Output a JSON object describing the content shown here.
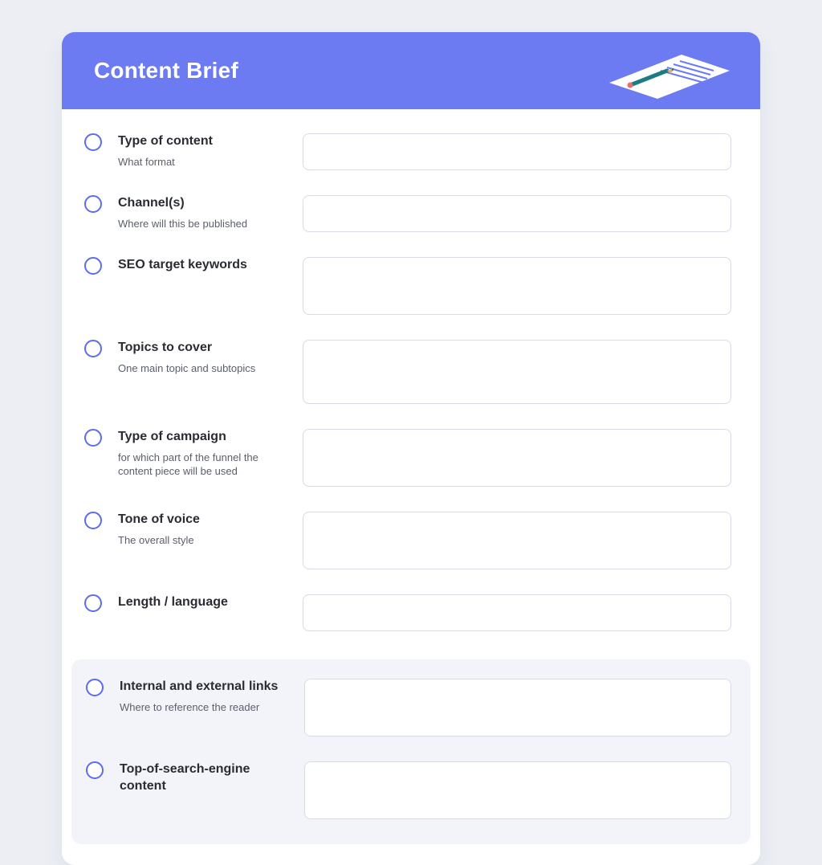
{
  "header": {
    "title": "Content Brief"
  },
  "fields": [
    {
      "id": "type-of-content",
      "title": "Type of content",
      "sub": "What format",
      "size": "sm",
      "value": ""
    },
    {
      "id": "channels",
      "title": "Channel(s)",
      "sub": "Where will this be published",
      "size": "sm",
      "value": ""
    },
    {
      "id": "seo-keywords",
      "title": "SEO target keywords",
      "sub": "",
      "size": "md",
      "value": ""
    },
    {
      "id": "topics-to-cover",
      "title": "Topics to cover",
      "sub": "One main topic and subtopics",
      "size": "lg",
      "value": ""
    },
    {
      "id": "type-of-campaign",
      "title": "Type of campaign",
      "sub": "for which part of the funnel the content piece will be used",
      "size": "md",
      "value": ""
    },
    {
      "id": "tone-of-voice",
      "title": "Tone of voice",
      "sub": "The overall style",
      "size": "md",
      "value": ""
    },
    {
      "id": "length-language",
      "title": "Length / language",
      "sub": "",
      "size": "sm",
      "value": ""
    }
  ],
  "secondary_fields": [
    {
      "id": "internal-external-links",
      "title": "Internal and external links",
      "sub": "Where to reference the reader",
      "size": "md",
      "value": ""
    },
    {
      "id": "top-of-search-content",
      "title": "Top-of-search-engine content",
      "sub": "",
      "size": "md",
      "value": ""
    }
  ]
}
